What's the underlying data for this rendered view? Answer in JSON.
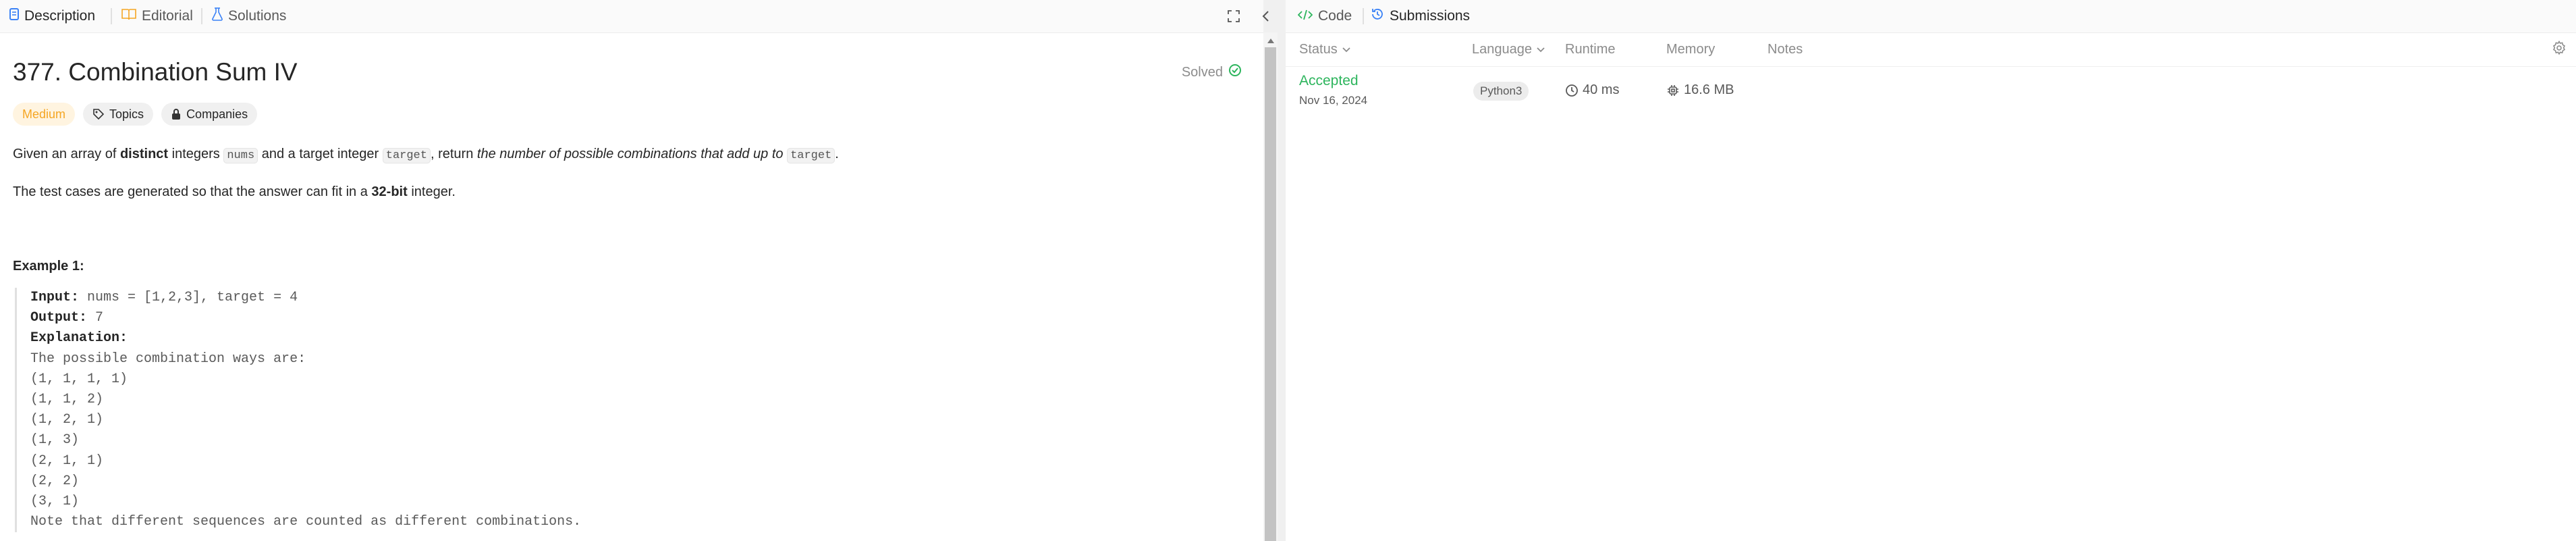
{
  "left": {
    "tabs": [
      {
        "label": "Description",
        "icon": "description-icon",
        "color": "#3b82f6"
      },
      {
        "label": "Editorial",
        "icon": "book-icon",
        "color": "#f5a623"
      },
      {
        "label": "Solutions",
        "icon": "flask-icon",
        "color": "#3b82f6"
      }
    ],
    "problem": {
      "title": "377. Combination Sum IV",
      "status": "Solved",
      "difficulty": "Medium",
      "chips": {
        "topics": "Topics",
        "companies": "Companies"
      }
    },
    "description": {
      "p1_a": "Given an array of ",
      "p1_b": "distinct",
      "p1_c": " integers ",
      "p1_code1": "nums",
      "p1_d": " and a target integer ",
      "p1_code2": "target",
      "p1_e": ", return ",
      "p1_f": "the number of possible combinations that add up to",
      "p1_code3": "target",
      "p1_g": ".",
      "p2_a": "The test cases are generated so that the answer can fit in a ",
      "p2_b": "32-bit",
      "p2_c": " integer."
    },
    "example": {
      "title": "Example 1:",
      "input_label": "Input:",
      "input_value": " nums = [1,2,3], target = 4",
      "output_label": "Output:",
      "output_value": " 7",
      "explanation_label": "Explanation:",
      "lines": [
        "The possible combination ways are:",
        "(1, 1, 1, 1)",
        "(1, 1, 2)",
        "(1, 2, 1)",
        "(1, 3)",
        "(2, 1, 1)",
        "(2, 2)",
        "(3, 1)",
        "Note that different sequences are counted as different combinations."
      ]
    }
  },
  "right": {
    "tabs": [
      {
        "label": "Code",
        "icon": "code-icon",
        "color": "#2db55d"
      },
      {
        "label": "Submissions",
        "icon": "history-icon",
        "color": "#3b82f6"
      }
    ],
    "columns": {
      "status": "Status",
      "language": "Language",
      "runtime": "Runtime",
      "memory": "Memory",
      "notes": "Notes"
    },
    "submission": {
      "status": "Accepted",
      "date": "Nov 16, 2024",
      "language": "Python3",
      "runtime": "40 ms",
      "memory": "16.6 MB"
    }
  },
  "colors": {
    "accepted": "#2db55d",
    "medium": "#f5a623",
    "accent": "#3b82f6"
  }
}
